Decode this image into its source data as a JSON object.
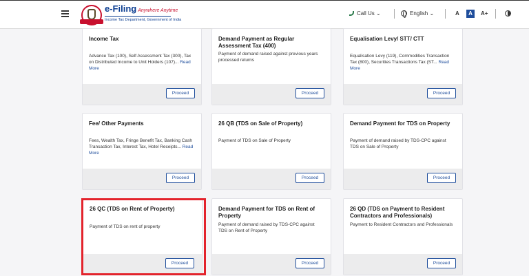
{
  "header": {
    "logo_title": "e-Filing",
    "logo_tag": "Anywhere Anytime",
    "logo_sub": "Income Tax Department, Government of India",
    "call_us": "Call Us",
    "language": "English",
    "font_decrease": "A",
    "font_normal": "A",
    "font_increase": "A+"
  },
  "cards": [
    {
      "title": "Income Tax",
      "desc": "Advance Tax (100), Self Assessment Tax (300), Tax on Distributed Income to Unit Holders (107)...",
      "read_more": "Read More",
      "button": "Proceed"
    },
    {
      "title": "Demand Payment as Regular Assessment Tax (400)",
      "desc": "Payment of demand raised against previous years processed returns",
      "read_more": "",
      "button": "Proceed"
    },
    {
      "title": "Equalisation Levy/ STT/ CTT",
      "desc": "Equalisation Levy (119), Commodities Transaction Tax (800), Securities Transactions Tax (ST...",
      "read_more": "Read More",
      "button": "Proceed"
    },
    {
      "title": "Fee/ Other Payments",
      "desc": "Fees, Wealth Tax, Fringe Benefit Tax, Banking Cash Transaction Tax, Interest Tax, Hotel Receipts...",
      "read_more": "Read More",
      "button": "Proceed"
    },
    {
      "title": "26 QB (TDS on Sale of Property)",
      "desc": "Payment of TDS on Sale of Property",
      "read_more": "",
      "button": "Proceed"
    },
    {
      "title": "Demand Payment for TDS on Property",
      "desc": "Payment of demand raised by TDS-CPC against TDS on Sale of Property",
      "read_more": "",
      "button": "Proceed"
    },
    {
      "title": "26 QC (TDS on Rent of Property)",
      "desc": "Payment of TDS on rent of property",
      "read_more": "",
      "button": "Proceed"
    },
    {
      "title": "Demand Payment for TDS on Rent of Property",
      "desc": "Payment of demand raised by TDS-CPC against TDS on Rent of Property",
      "read_more": "",
      "button": "Proceed"
    },
    {
      "title": "26 QD (TDS on Payment to Resident Contractors and Professionals)",
      "desc": "Payment to Resident Contractors and Professionals",
      "read_more": "",
      "button": "Proceed"
    }
  ],
  "colors": {
    "accent": "#1f4e9c",
    "highlight": "#e3232c"
  }
}
